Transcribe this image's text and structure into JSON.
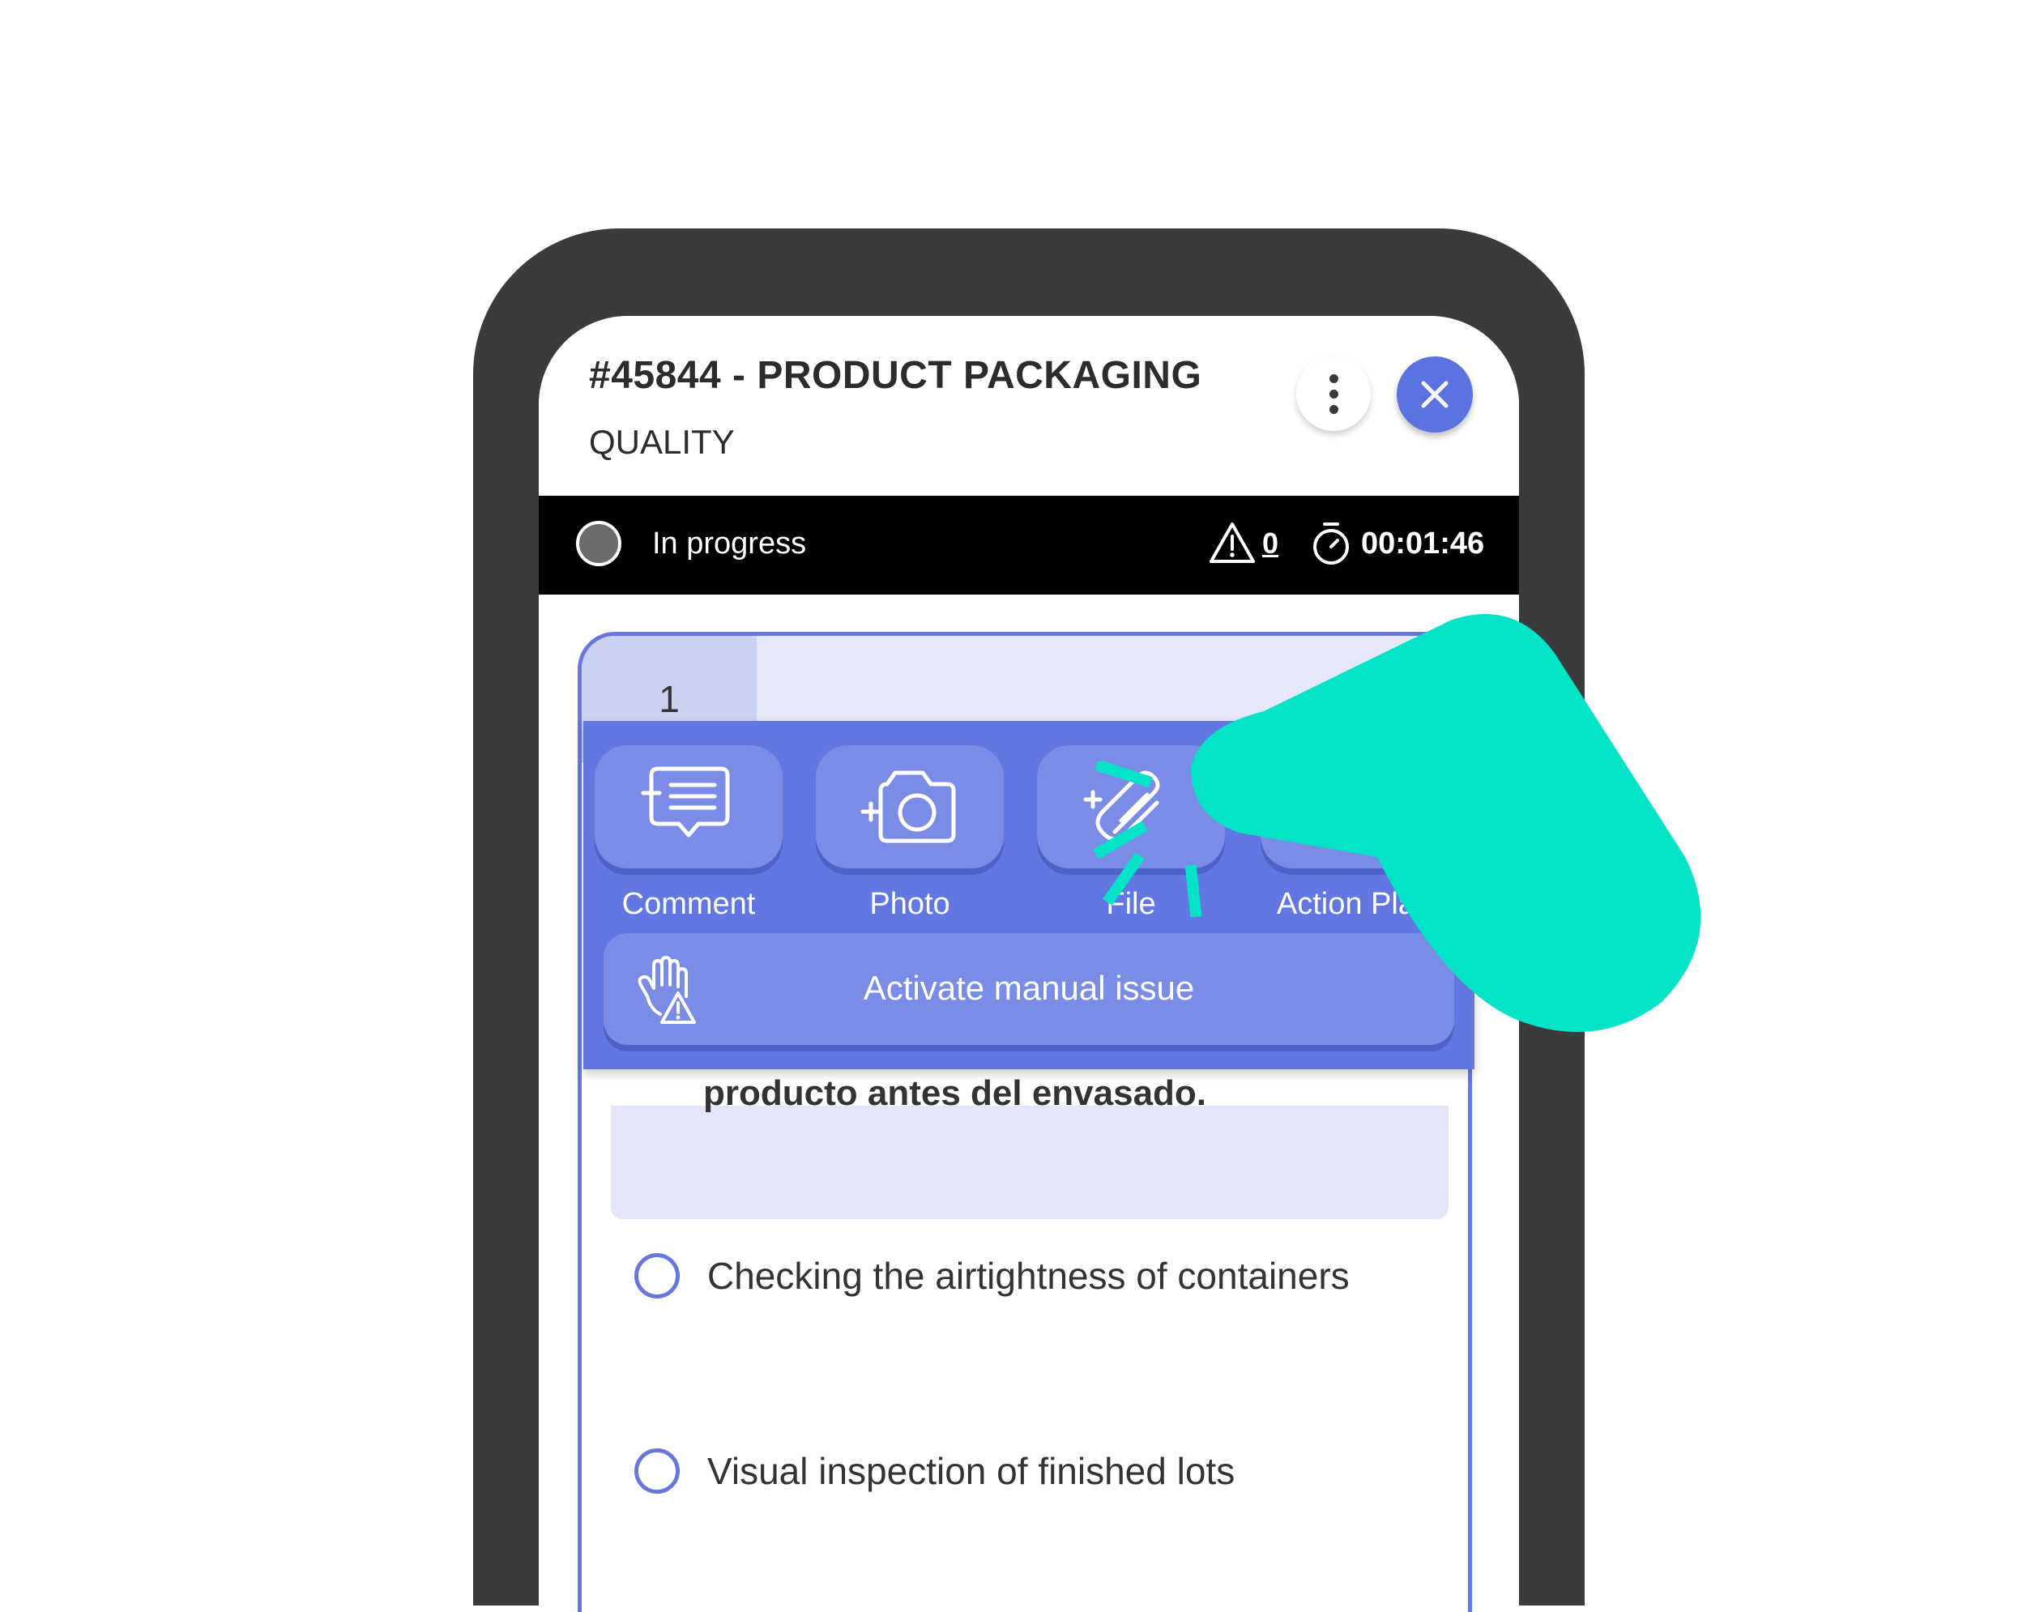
{
  "header": {
    "title": "#45844 - PRODUCT PACKAGING",
    "subtitle": "QUALITY",
    "menu_icon": "more-vertical-icon",
    "close_icon": "close-icon"
  },
  "status": {
    "state": "In progress",
    "alert_count": "0",
    "timer": "00:01:46"
  },
  "question": {
    "number": "1",
    "text": "producto antes del envasado.",
    "options": [
      "Checking the airtightness of containers",
      "Visual inspection of finished lots"
    ]
  },
  "actions": {
    "items": [
      {
        "label": "Comment",
        "icon": "add-comment-icon"
      },
      {
        "label": "Photo",
        "icon": "add-photo-icon"
      },
      {
        "label": "File",
        "icon": "attach-file-icon"
      },
      {
        "label": "Action Plan",
        "icon": "add-action-plan-icon"
      }
    ],
    "manual_issue": "Activate manual issue"
  },
  "colors": {
    "accent": "#5b73e0",
    "overlay": "#6277e1",
    "pointer_hand": "#03e3c8"
  }
}
